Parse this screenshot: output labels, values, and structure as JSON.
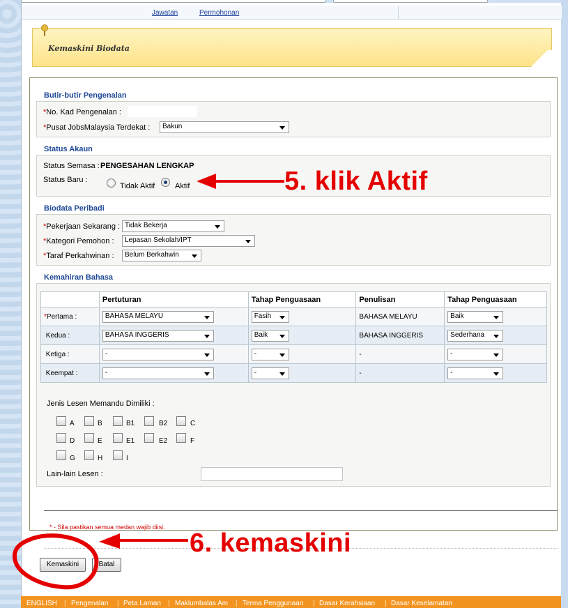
{
  "nav": {
    "link1": "Jawatan",
    "link2": "Permohonan"
  },
  "banner": {
    "title": "Kemaskini Biodata"
  },
  "pengenalan": {
    "section": "Butir-butir Pengenalan",
    "ic_label": "No. Kad Pengenalan :",
    "ic_value": "",
    "pusat_label": "Pusat JobsMalaysia Terdekat :",
    "pusat_value": "Bakun"
  },
  "akaun": {
    "section": "Status Akaun",
    "semasa_label": "Status Semasa :",
    "semasa_value": "PENGESAHAN LENGKAP",
    "baru_label": "Status Baru :",
    "opt_tidak": "Tidak Aktif",
    "opt_aktif": "Aktif",
    "selected": "Aktif"
  },
  "biodata": {
    "section": "Biodata Peribadi",
    "pekerjaan_label": "Pekerjaan Sekarang :",
    "pekerjaan_value": "Tidak Bekerja",
    "kategori_label": "Kategori Pemohon :",
    "kategori_value": "Lepasan Sekolah/IPT",
    "taraf_label": "Taraf Perkahwinan :",
    "taraf_value": "Belum Berkahwin"
  },
  "bahasa": {
    "section": "Kemahiran Bahasa",
    "headers": [
      "",
      "Pertuturan",
      "Tahap Penguasaan",
      "Penulisan",
      "Tahap Penguasaan"
    ],
    "rows": [
      {
        "label": "Pertama :",
        "required": true,
        "pertuturan": "BAHASA MELAYU",
        "tahap1": "Fasih",
        "penulisan": "BAHASA MELAYU",
        "tahap2": "Baik"
      },
      {
        "label": "Kedua :",
        "required": false,
        "pertuturan": "BAHASA INGGERIS",
        "tahap1": "Baik",
        "penulisan": "BAHASA INGGERIS",
        "tahap2": "Sederhana"
      },
      {
        "label": "Ketiga :",
        "required": false,
        "pertuturan": "-",
        "tahap1": "-",
        "penulisan": "-",
        "tahap2": "-"
      },
      {
        "label": "Keempat :",
        "required": false,
        "pertuturan": "-",
        "tahap1": "-",
        "penulisan": "-",
        "tahap2": "-"
      }
    ]
  },
  "lesen": {
    "label": "Jenis Lesen Memandu Dimiliki :",
    "row1": [
      "A",
      "B",
      "B1",
      "B2",
      "C"
    ],
    "row2": [
      "D",
      "E",
      "E1",
      "E2",
      "F"
    ],
    "row3": [
      "G",
      "H",
      "I"
    ],
    "lain_label": "Lain-lain Lesen :",
    "lain_value": ""
  },
  "note": "* - Sila pastikan semua medan wajib diisi.",
  "buttons": {
    "kemaskini": "Kemaskini",
    "batal": "Batal"
  },
  "footer": [
    "ENGLISH",
    "Pengenalan",
    "Peta Laman",
    "Maklumbalas Am",
    "Terma Penggunaan",
    "Dasar Kerahsiaan",
    "Dasar Keselamatan"
  ],
  "annotations": {
    "step5": "5. klik Aktif",
    "step6": "6. kemaskini",
    "color": "#e50000"
  },
  "colors": {
    "section_title": "#1f4896",
    "footer": "#f39420",
    "required": "#d20000",
    "banner": "#fde38a"
  }
}
